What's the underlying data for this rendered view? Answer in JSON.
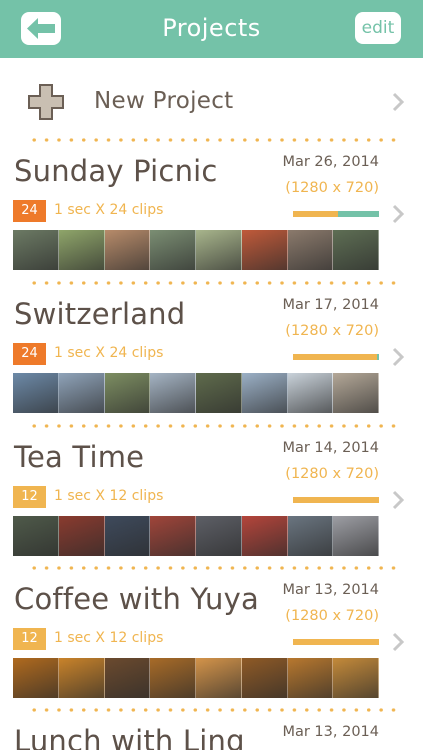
{
  "nav": {
    "back_icon": "back-arrow-icon",
    "title": "Projects",
    "edit_label": "edit",
    "color": "#74c2a8"
  },
  "new_project": {
    "icon": "plus-icon",
    "label": "New Project"
  },
  "accent_colors": {
    "yellow": "#f0b550",
    "orange": "#ee7a2a",
    "teal": "#74c2a8",
    "text": "#5d5149"
  },
  "projects": [
    {
      "title": "Sunday Picnic",
      "date": "Mar 26, 2014",
      "resolution": "(1280 x 720)",
      "count": "24",
      "clips": "1 sec X 24 clips",
      "badge_color": "#ee7a2a",
      "progress_yellow": 0.52,
      "progress_teal": 0.48,
      "thumb_colors": [
        "#6c7a64",
        "#8fa56a",
        "#b78b6a",
        "#7b8e73",
        "#a8b58c",
        "#c05a3a",
        "#8b7a6c",
        "#5e6e54"
      ]
    },
    {
      "title": "Switzerland",
      "date": "Mar 17, 2014",
      "resolution": "(1280 x 720)",
      "count": "24",
      "clips": "1 sec X 24 clips",
      "badge_color": "#ee7a2a",
      "progress_yellow": 0.97,
      "progress_teal": 0.03,
      "thumb_colors": [
        "#6d8aa8",
        "#8fa3b9",
        "#7d8e62",
        "#a5b4c4",
        "#5f6b4c",
        "#9bb0c6",
        "#c9d2da",
        "#b4a898"
      ]
    },
    {
      "title": "Tea Time",
      "date": "Mar 14, 2014",
      "resolution": "(1280 x 720)",
      "count": "12",
      "clips": "1 sec X 12 clips",
      "badge_color": "#f0b550",
      "progress_yellow": 1.0,
      "progress_teal": 0.0,
      "thumb_colors": [
        "#4f5a4a",
        "#8a3b2f",
        "#3e4a5c",
        "#a0453a",
        "#5d5f66",
        "#b4453b",
        "#6a7580",
        "#9d9ea4"
      ]
    },
    {
      "title": "Coffee with Yuya",
      "date": "Mar 13, 2014",
      "resolution": "(1280 x 720)",
      "count": "12",
      "clips": "1 sec X 12 clips",
      "badge_color": "#f0b550",
      "progress_yellow": 1.0,
      "progress_teal": 0.0,
      "thumb_colors": [
        "#b06a1e",
        "#c9832a",
        "#6b4a2e",
        "#a86b28",
        "#d4944a",
        "#8f5a26",
        "#b8782e",
        "#c48a3a"
      ]
    },
    {
      "title": "Lunch with Ling",
      "date": "Mar 13, 2014"
    }
  ]
}
